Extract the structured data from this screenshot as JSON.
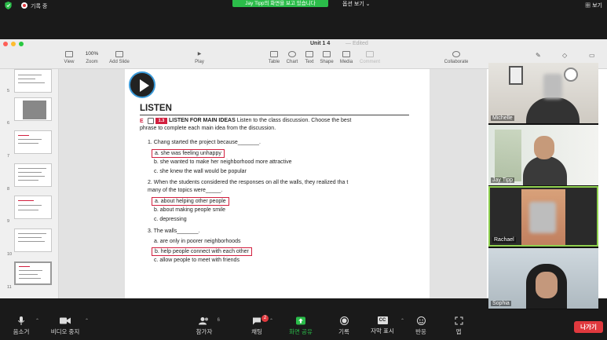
{
  "zoom_top": {
    "recording_label": "기록 중",
    "share_banner": "Jay Tipp의 화면을 보고 있습니다",
    "view_options_label": "옵션 보기",
    "view_label": "보기"
  },
  "keynote": {
    "doc_title": "Unit 1 4",
    "edited_label": "— Edited",
    "toolbar": {
      "view": "View",
      "zoom": "Zoom",
      "zoom_value": "100%",
      "add_slide": "Add Slide",
      "play": "Play",
      "table": "Table",
      "chart": "Chart",
      "text": "Text",
      "shape": "Shape",
      "media": "Media",
      "comment": "Comment",
      "collaborate": "Collaborate"
    },
    "slide_numbers": [
      "5",
      "6",
      "7",
      "8",
      "9",
      "10",
      "11"
    ]
  },
  "slide": {
    "heading": "LISTEN",
    "exercise_letter": "E",
    "badge": "1.3",
    "instruction_title": "LISTEN FOR MAIN IDEAS",
    "instruction_text": "Listen to the class discussion. Choose the best phrase to complete each main idea from the discussion.",
    "questions": [
      {
        "stem": "1. Chang started the project because_______.",
        "options": [
          "a. she was feeling unhappy",
          "b. she wanted to make her neighborhood more attractive",
          "c. she knew the wall would be popular"
        ]
      },
      {
        "stem": "2. When the students considered the responses on all the walls, they realized tha t many of the topics were_____.",
        "options": [
          "a. about helping other people",
          "b. about making people smile",
          "c. depressing"
        ]
      },
      {
        "stem": "3. The walls_______.",
        "options": [
          "a. are only in poorer neighborhoods",
          "b. help people connect with each other",
          "c. allow people to meet with friends"
        ]
      }
    ]
  },
  "participants": [
    {
      "name": "Michelle"
    },
    {
      "name": "Jay Tipp"
    },
    {
      "name": "Rachael"
    },
    {
      "name": "Sophia"
    }
  ],
  "zoom_bottom": {
    "mute": "음소거",
    "stop_video": "비디오 중지",
    "participants": "참가자",
    "participants_count": "6",
    "chat": "채팅",
    "chat_badge": "2",
    "share_screen": "화면 공유",
    "record": "기록",
    "captions": "자막 표시",
    "captions_icon_text": "CC",
    "reactions": "반응",
    "apps": "앱",
    "leave": "나가기"
  },
  "colors": {
    "accent_red": "#d2203f",
    "zoom_green": "#2bbd4a",
    "leave_red": "#e0393e"
  }
}
